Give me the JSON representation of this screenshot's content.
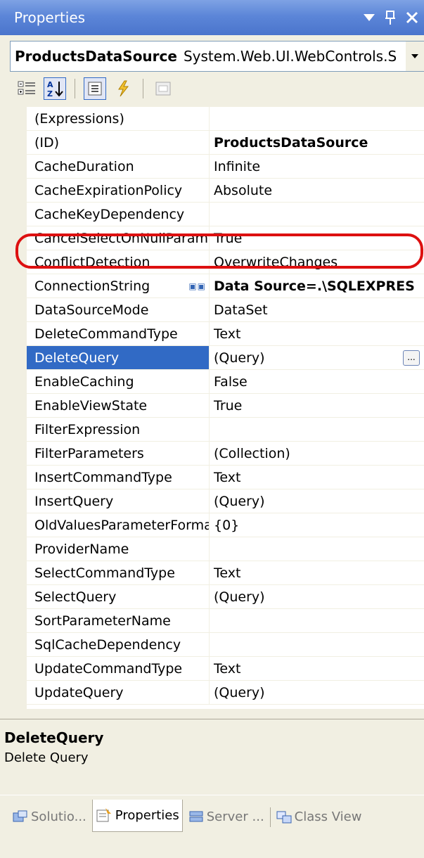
{
  "window": {
    "title": "Properties",
    "pin_glyph": "p",
    "close_glyph": "✕"
  },
  "object_selector": {
    "name": "ProductsDataSource",
    "type": "System.Web.UI.WebControls.S"
  },
  "toolbar": {
    "categorized_icon": "categorized-icon",
    "alphabetical_icon": "alphabetical-icon",
    "properties_icon": "properties-icon",
    "events_icon": "events-icon",
    "property_pages_icon": "property-pages-icon"
  },
  "grid": {
    "rows": [
      {
        "name": "(Expressions)",
        "value": ""
      },
      {
        "name": "(ID)",
        "value": "ProductsDataSource"
      },
      {
        "name": "CacheDuration",
        "value": "Infinite"
      },
      {
        "name": "CacheExpirationPolicy",
        "value": "Absolute"
      },
      {
        "name": "CacheKeyDependency",
        "value": ""
      },
      {
        "name": "CancelSelectOnNullParamet",
        "value": "True"
      },
      {
        "name": "ConflictDetection",
        "value": "OverwriteChanges"
      },
      {
        "name": "ConnectionString",
        "value": "Data Source=.\\SQLEXPRES"
      },
      {
        "name": "DataSourceMode",
        "value": "DataSet"
      },
      {
        "name": "DeleteCommandType",
        "value": "Text"
      },
      {
        "name": "DeleteQuery",
        "value": "(Query)"
      },
      {
        "name": "EnableCaching",
        "value": "False"
      },
      {
        "name": "EnableViewState",
        "value": "True"
      },
      {
        "name": "FilterExpression",
        "value": ""
      },
      {
        "name": "FilterParameters",
        "value": "(Collection)"
      },
      {
        "name": "InsertCommandType",
        "value": "Text"
      },
      {
        "name": "InsertQuery",
        "value": "(Query)"
      },
      {
        "name": "OldValuesParameterForma",
        "value": "{0}"
      },
      {
        "name": "ProviderName",
        "value": ""
      },
      {
        "name": "SelectCommandType",
        "value": "Text"
      },
      {
        "name": "SelectQuery",
        "value": "(Query)"
      },
      {
        "name": "SortParameterName",
        "value": ""
      },
      {
        "name": "SqlCacheDependency",
        "value": ""
      },
      {
        "name": "UpdateCommandType",
        "value": "Text"
      },
      {
        "name": "UpdateQuery",
        "value": "(Query)"
      }
    ],
    "selected_row": "DeleteQuery",
    "ellipsis_label": "...",
    "conn_icon_label": "▣▣"
  },
  "description": {
    "title": "DeleteQuery",
    "text": "Delete Query"
  },
  "tabs": [
    {
      "label": "Solutio...",
      "icon": "solution-explorer-icon"
    },
    {
      "label": "Properties",
      "icon": "properties-window-icon"
    },
    {
      "label": "Server ...",
      "icon": "server-explorer-icon"
    },
    {
      "label": "Class View",
      "icon": "class-view-icon"
    }
  ],
  "colors": {
    "selection": "#316ac5",
    "highlight_oval": "#dd1010",
    "titlebar": "#5c86d8"
  }
}
